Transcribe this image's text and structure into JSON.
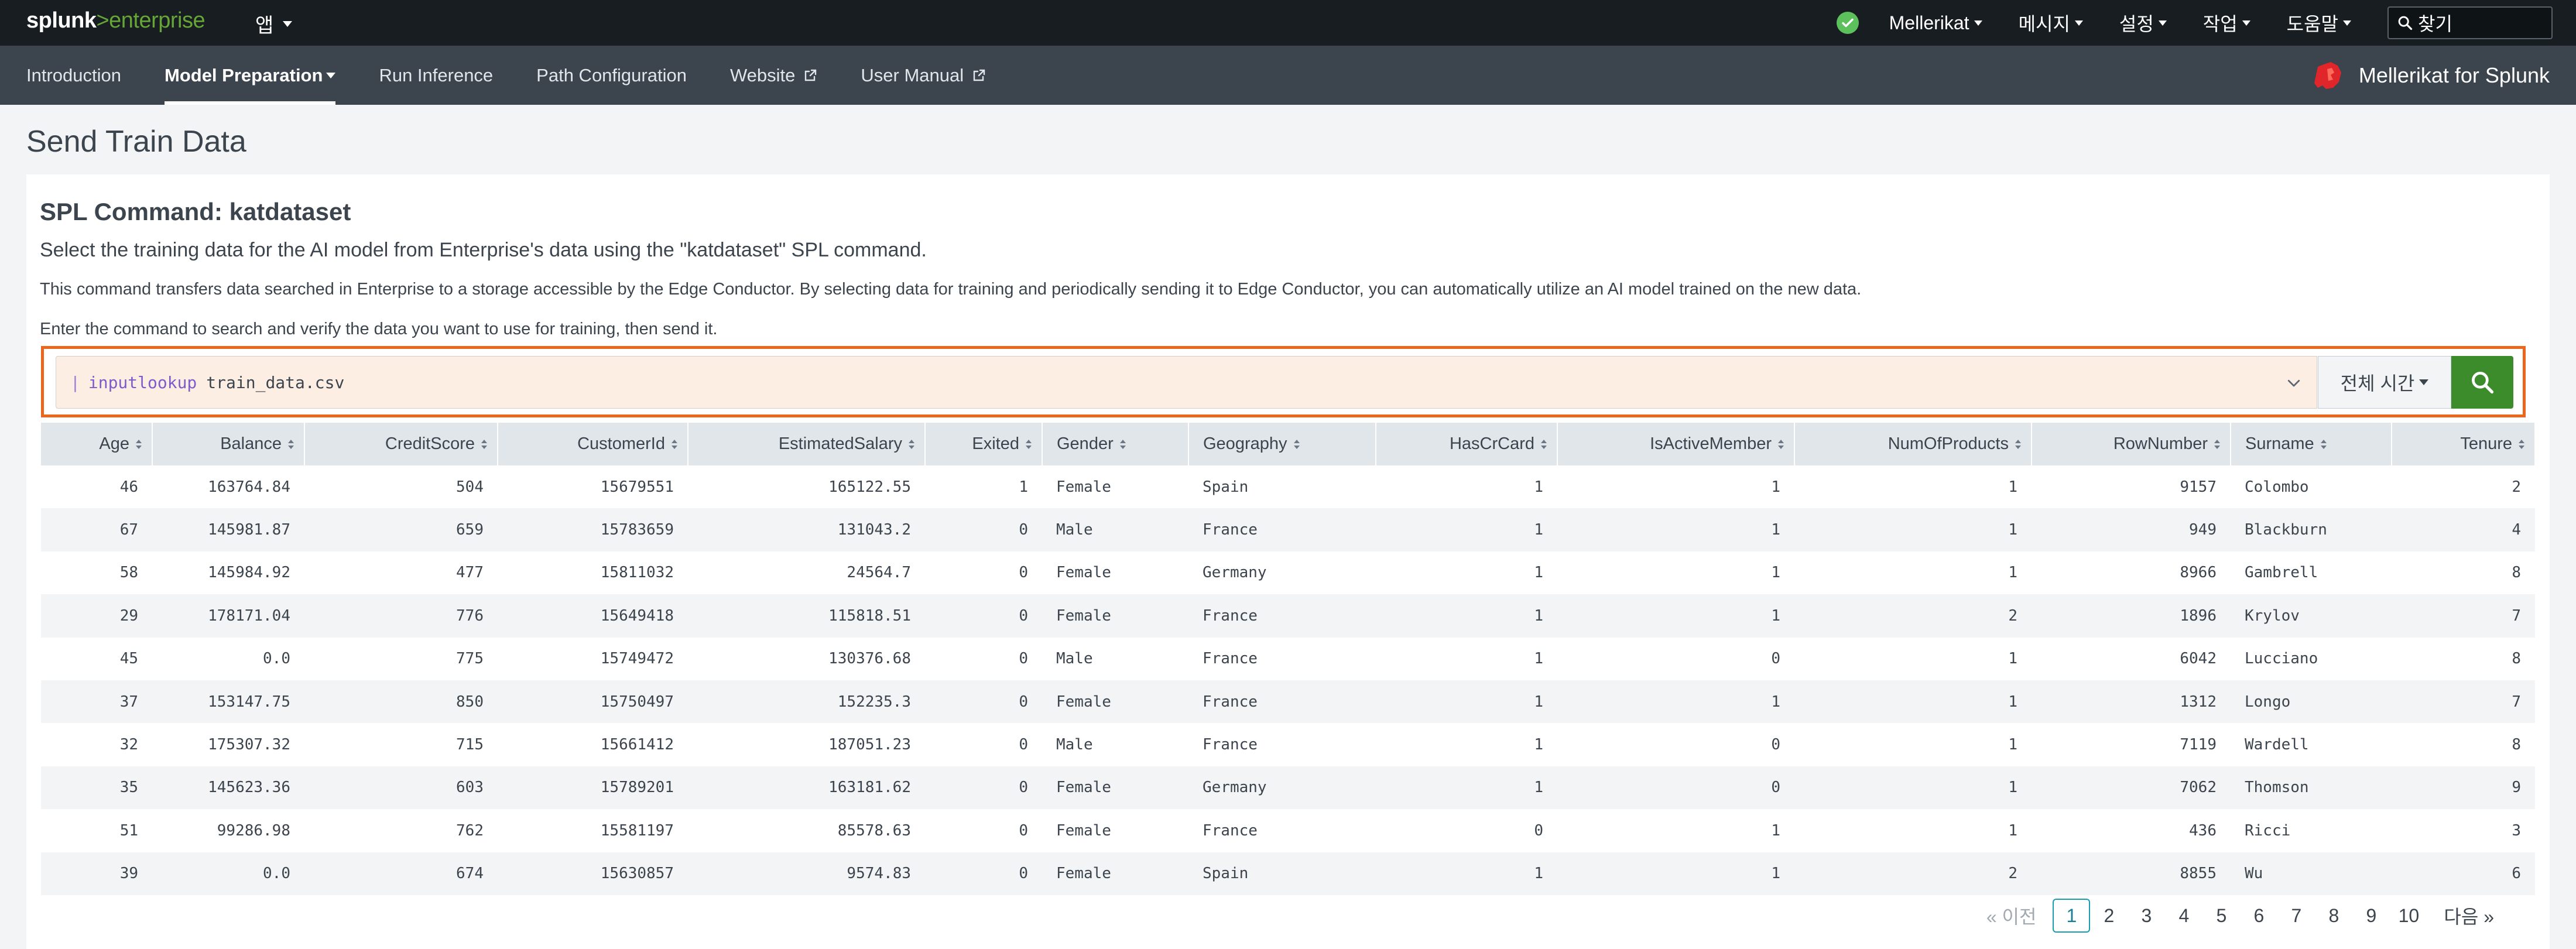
{
  "topbar": {
    "logo_bold": "splunk",
    "logo_rest": ">enterprise",
    "apps_label": "앱",
    "menus": [
      {
        "label": "Mellerikat"
      },
      {
        "label": "메시지"
      },
      {
        "label": "설정"
      },
      {
        "label": "작업"
      },
      {
        "label": "도움말"
      }
    ],
    "search_label": "찾기",
    "status_color": "#5cc05c"
  },
  "appbar": {
    "nav": [
      {
        "label": "Introduction",
        "active": false,
        "dropdown": false,
        "external": false
      },
      {
        "label": "Model Preparation",
        "active": true,
        "dropdown": true,
        "external": false
      },
      {
        "label": "Run Inference",
        "active": false,
        "dropdown": false,
        "external": false
      },
      {
        "label": "Path Configuration",
        "active": false,
        "dropdown": false,
        "external": false
      },
      {
        "label": "Website",
        "active": false,
        "dropdown": false,
        "external": true
      },
      {
        "label": "User Manual",
        "active": false,
        "dropdown": false,
        "external": true
      }
    ],
    "brand_label": "Mellerikat for Splunk",
    "brand_color": "#e0262a"
  },
  "page": {
    "title": "Send Train Data"
  },
  "panel": {
    "title": "SPL Command: katdataset",
    "desc1": "Select the training data for the AI model from Enterprise's data using the \"katdataset\" SPL command.",
    "desc2": "This command transfers data searched in Enterprise to a storage accessible by the Edge Conductor. By selecting data for training and periodically sending it to Edge Conductor, you can automatically utilize an AI model trained on the new data.",
    "desc3": "Enter the command to search and verify the data you want to use for training, then send it."
  },
  "search": {
    "pipe": "|",
    "command": "inputlookup",
    "argument": "train_data.csv",
    "time_range": "전체 시간",
    "highlight_color": "#e9661c",
    "button_color": "#3d8c2b"
  },
  "table": {
    "columns": [
      "Age",
      "Balance",
      "CreditScore",
      "CustomerId",
      "EstimatedSalary",
      "Exited",
      "Gender",
      "Geography",
      "HasCrCard",
      "IsActiveMember",
      "NumOfProducts",
      "RowNumber",
      "Surname",
      "Tenure"
    ],
    "rows": [
      [
        "46",
        "163764.84",
        "504",
        "15679551",
        "165122.55",
        "1",
        "Female",
        "Spain",
        "1",
        "1",
        "1",
        "9157",
        "Colombo",
        "2"
      ],
      [
        "67",
        "145981.87",
        "659",
        "15783659",
        "131043.2",
        "0",
        "Male",
        "France",
        "1",
        "1",
        "1",
        "949",
        "Blackburn",
        "4"
      ],
      [
        "58",
        "145984.92",
        "477",
        "15811032",
        "24564.7",
        "0",
        "Female",
        "Germany",
        "1",
        "1",
        "1",
        "8966",
        "Gambrell",
        "8"
      ],
      [
        "29",
        "178171.04",
        "776",
        "15649418",
        "115818.51",
        "0",
        "Female",
        "France",
        "1",
        "1",
        "2",
        "1896",
        "Krylov",
        "7"
      ],
      [
        "45",
        "0.0",
        "775",
        "15749472",
        "130376.68",
        "0",
        "Male",
        "France",
        "1",
        "0",
        "1",
        "6042",
        "Lucciano",
        "8"
      ],
      [
        "37",
        "153147.75",
        "850",
        "15750497",
        "152235.3",
        "0",
        "Female",
        "France",
        "1",
        "1",
        "1",
        "1312",
        "Longo",
        "7"
      ],
      [
        "32",
        "175307.32",
        "715",
        "15661412",
        "187051.23",
        "0",
        "Male",
        "France",
        "1",
        "0",
        "1",
        "7119",
        "Wardell",
        "8"
      ],
      [
        "35",
        "145623.36",
        "603",
        "15789201",
        "163181.62",
        "0",
        "Female",
        "Germany",
        "1",
        "0",
        "1",
        "7062",
        "Thomson",
        "9"
      ],
      [
        "51",
        "99286.98",
        "762",
        "15581197",
        "85578.63",
        "0",
        "Female",
        "France",
        "0",
        "1",
        "1",
        "436",
        "Ricci",
        "3"
      ],
      [
        "39",
        "0.0",
        "674",
        "15630857",
        "9574.83",
        "0",
        "Female",
        "Spain",
        "1",
        "1",
        "2",
        "8855",
        "Wu",
        "6"
      ]
    ]
  },
  "pager": {
    "prev_label": "« 이전",
    "pages": [
      "1",
      "2",
      "3",
      "4",
      "5",
      "6",
      "7",
      "8",
      "9",
      "10"
    ],
    "current_page": "1",
    "next_label": "다음 »",
    "accent_color": "#1a9cb0"
  }
}
